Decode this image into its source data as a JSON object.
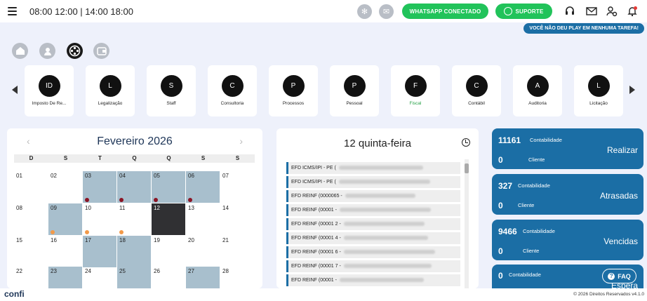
{
  "header": {
    "hours": "08:00 12:00 | 14:00 18:00",
    "whatsapp_label": "WHATSAPP CONECTADO",
    "support_label": "SUPORTE",
    "notice": "VOCÊ NÃO DEU PLAY EM NENHUMA TAREFA!",
    "icons": [
      "menu-icon",
      "spinner-icon",
      "mail-box-icon",
      "headset-icon",
      "envelope-icon",
      "user-settings-icon",
      "bell-icon"
    ]
  },
  "nav": {
    "icons": [
      "home-icon",
      "user-icon",
      "film-reel-icon",
      "wallet-icon"
    ]
  },
  "departments": [
    {
      "initial": "ID",
      "label": "Imposto De Re..."
    },
    {
      "initial": "L",
      "label": "Legalização"
    },
    {
      "initial": "S",
      "label": "Staff"
    },
    {
      "initial": "C",
      "label": "Consultoria"
    },
    {
      "initial": "P",
      "label": "Processos"
    },
    {
      "initial": "P",
      "label": "Pessoal"
    },
    {
      "initial": "F",
      "label": "Fiscal",
      "active": true
    },
    {
      "initial": "C",
      "label": "Contábil"
    },
    {
      "initial": "A",
      "label": "Auditoria"
    },
    {
      "initial": "L",
      "label": "Licitação"
    }
  ],
  "calendar": {
    "title": "Fevereiro 2026",
    "prev": "‹",
    "next": "›",
    "weekdays": [
      "D",
      "S",
      "T",
      "Q",
      "Q",
      "S",
      "S"
    ],
    "days": [
      "01",
      "02",
      "03",
      "04",
      "05",
      "06",
      "07",
      "08",
      "09",
      "10",
      "11",
      "12",
      "13",
      "14",
      "15",
      "16",
      "17",
      "18",
      "19",
      "20",
      "21",
      "22",
      "23",
      "24",
      "25",
      "26",
      "27",
      "28"
    ]
  },
  "agenda": {
    "title": "12 quinta-feira",
    "tasks": [
      "EFD ICMS/IPI - PE (",
      "EFD ICMS/IPI - PE (",
      "EFD REINF (0000065 -",
      "EFD REINF (00001 -",
      "EFD REINF (00001 2 -",
      "EFD REINF (00001 4 -",
      "EFD REINF (00001 6 -",
      "EFD REINF (00001 7 -",
      "EFD REINF (00001 -"
    ]
  },
  "stats": [
    {
      "num": "11161",
      "sub1": "Contabilidade",
      "zero": "0",
      "sub2": "Cliente",
      "status": "Realizar"
    },
    {
      "num": "327",
      "sub1": "Contabilidade",
      "zero": "0",
      "sub2": "Cliente",
      "status": "Atrasadas"
    },
    {
      "num": "9466",
      "sub1": "Contabilidade",
      "zero": "0",
      "sub2": "Cliente",
      "status": "Vencidas"
    },
    {
      "num": "0",
      "sub1": "Contabilidade",
      "zero": "",
      "sub2": "",
      "status": "Espera"
    }
  ],
  "faq": "FAQ",
  "footer": {
    "logo": "confi",
    "copyright": "© 2026 Direitos Reservados v4.1.0"
  },
  "colors": {
    "accent": "#1b6ea5",
    "green": "#21c35a",
    "highlight": "#a8bfcd",
    "today": "#303033",
    "dot_red": "#8b1424",
    "dot_orange": "#f29a4a"
  }
}
